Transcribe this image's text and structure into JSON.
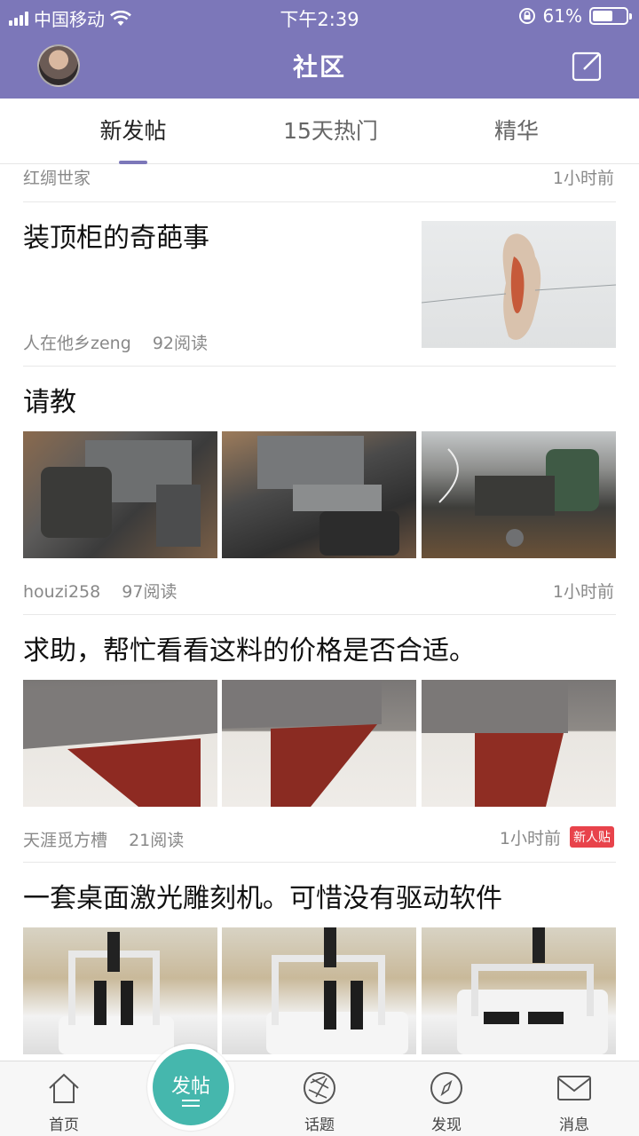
{
  "status_bar": {
    "carrier": "中国移动",
    "time": "下午2:39",
    "battery": "61%",
    "battery_level": 0.61
  },
  "nav": {
    "title": "社区"
  },
  "tabs": [
    "新发帖",
    "15天热门",
    "精华"
  ],
  "active_tab": 0,
  "feed": {
    "partial_author": "红绸世家",
    "partial_time": "1小时前",
    "posts": [
      {
        "title": "装顶柜的奇葩事",
        "author": "人在他乡zeng",
        "reads": "92阅读"
      },
      {
        "title": "请教",
        "author": "houzi258",
        "reads": "97阅读",
        "time": "1小时前"
      },
      {
        "title": "求助，帮忙看看这料的价格是否合适。",
        "author": "天涯觅方槽",
        "reads": "21阅读",
        "time": "1小时前",
        "badge": "新人贴"
      },
      {
        "title": "一套桌面激光雕刻机。可惜没有驱动软件"
      }
    ]
  },
  "tabbar": {
    "home": "首页",
    "post": "发帖",
    "topics": "话题",
    "discover": "发现",
    "messages": "消息"
  },
  "colors": {
    "header": "#7c77b9",
    "fab": "#45b7ad",
    "badge": "#e8434b"
  }
}
